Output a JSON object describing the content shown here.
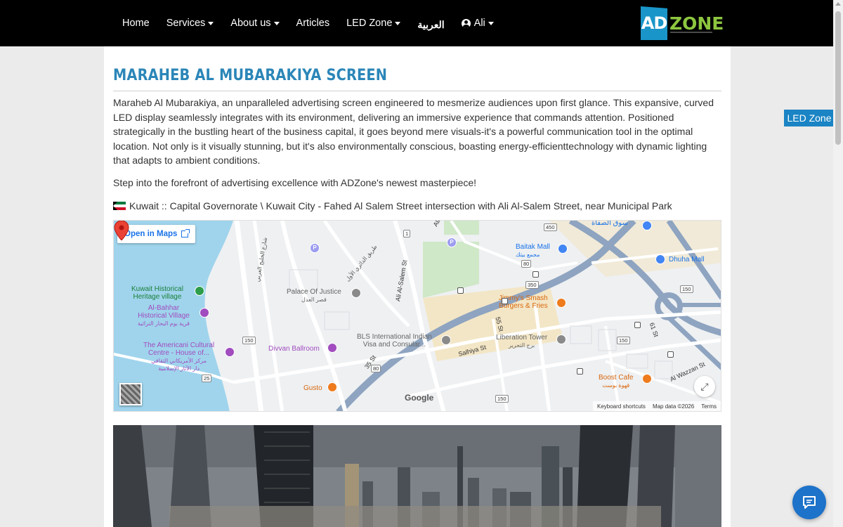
{
  "nav": {
    "items": [
      {
        "label": "Home",
        "dropdown": false
      },
      {
        "label": "Services",
        "dropdown": true
      },
      {
        "label": "About us",
        "dropdown": true
      },
      {
        "label": "Articles",
        "dropdown": false
      },
      {
        "label": "LED Zone",
        "dropdown": true
      },
      {
        "label": "العربية",
        "dropdown": false
      },
      {
        "label": "Ali",
        "dropdown": true
      }
    ],
    "logo_ad": "AD",
    "logo_zone": "ZONE"
  },
  "page": {
    "title": "MARAHEB AL MUBARAKIYA SCREEN",
    "description": "Maraheb Al Mubarakiya, an unparalleled advertising screen engineered to mesmerize audiences upon first glance. This expansive, curved LED display seamlessly integrates with its environment, delivering an immersive experience that commands attention. Positioned strategically in the bustling heart of the business capital, it goes beyond mere visuals-it's a powerful communication tool in the optimal location. Not only is it visually stunning, but it's also environmentally conscious, boasting energy-efficienttechnology with dynamic lighting that adapts to ambient conditions.",
    "tagline": "Step into the forefront of advertising excellence with ADZone's newest masterpiece!",
    "location": "Kuwait :: Capital Governorate \\ Kuwait City - Fahed Al Salem Street intersection with Ali Al-Salem Street, near Municipal Park"
  },
  "map": {
    "open_label": "Open in Maps",
    "footer": {
      "shortcuts": "Keyboard shortcuts",
      "data": "Map data ©2026",
      "terms": "Terms"
    },
    "google": "Google",
    "labels": {
      "kuwait_heritage": "Kuwait Historical\nHeritage village",
      "al_bahhar": "Al-Bahhar\nHistorical Village",
      "al_bahhar_ar": "قرية بوم البحار التراثية",
      "americani": "The Americani Cultural\nCentre - House of...",
      "americani_ar": "مركز الأمريكاني الثقافي\nدار الآثار الإسلامية",
      "palace_justice": "Palace Of Justice",
      "palace_justice_ar": "قصر العدل",
      "divvan": "Divvan Ballroom",
      "gusto": "Gusto",
      "bls": "BLS International Indian\nVisa and Consular...",
      "liberation": "Liberation Tower",
      "liberation_ar": "برج التحرير",
      "jimmys": "Jimmy's Smash\nBurgers & Fries",
      "baitak": "Baitak Mall",
      "baitak_ar": "مجمع بيتك",
      "dhuha": "Dhuha Mall",
      "boost": "Boost Cafe",
      "boost_ar": "قهوة بوست",
      "safat": "سوق الصفاة",
      "ali_salem": "Ali Al-Salem St",
      "salhiya": "Salhiya St",
      "al_wazzan": "Al Wazzan St",
      "st55": "55 St",
      "st35": "35 St",
      "st61": "61 St",
      "gulf_road_ar": "شارع الخليج العربي",
      "first_ring_ar": "طريق الدائري الأول",
      "ali_abbr": "Ali"
    },
    "road_badges": [
      "1",
      "450",
      "80",
      "350",
      "150",
      "150",
      "150",
      "25",
      "80",
      "150"
    ]
  },
  "side_tab": "LED Zone",
  "colors": {
    "nav_bg": "#000000",
    "accent": "#2b86b8",
    "logo_blue": "#1a95c9",
    "logo_green": "#8dc63f",
    "side_tab": "#1a84c4",
    "chat": "#1d72c9"
  },
  "icons": {
    "user": "user-circle-icon",
    "external": "external-link-icon",
    "chat": "chat-bubble-icon",
    "pin": "map-pin-icon",
    "fullscreen": "fullscreen-icon"
  }
}
